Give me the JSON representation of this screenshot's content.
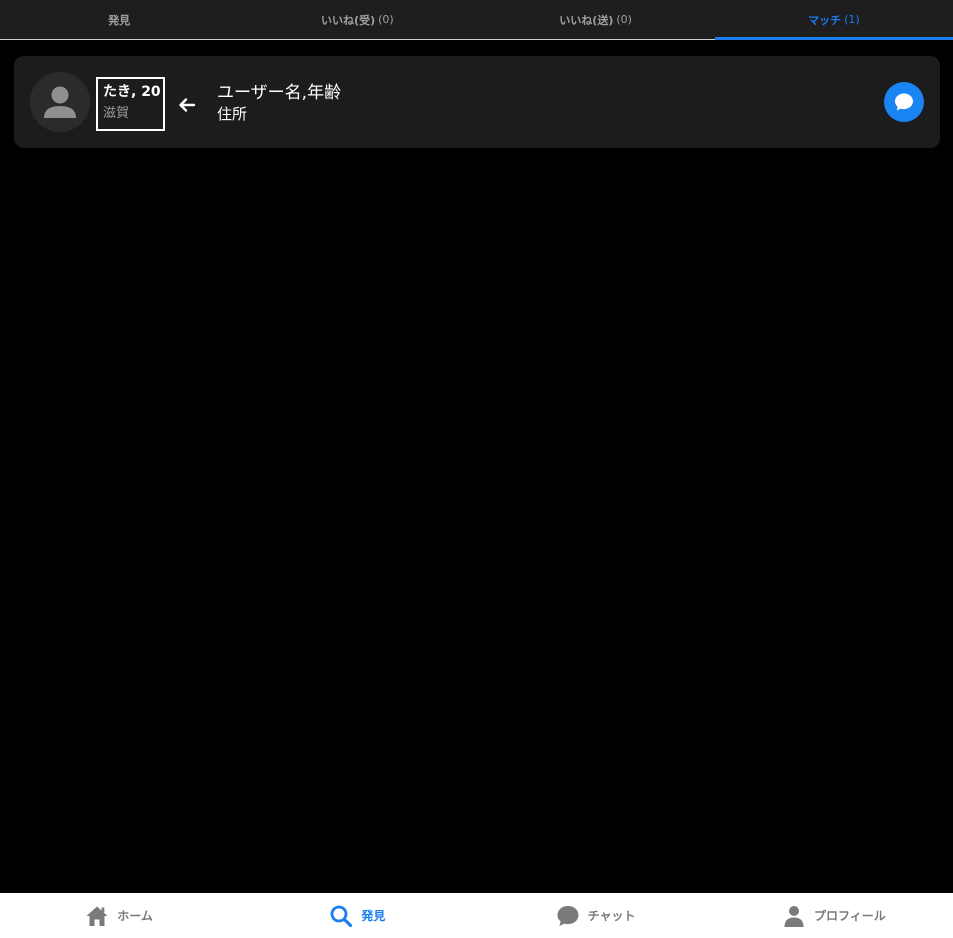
{
  "top_tabs": [
    {
      "label": "発見",
      "count": ""
    },
    {
      "label": "いいね(受)",
      "count": "(0)"
    },
    {
      "label": "いいね(送)",
      "count": "(0)"
    },
    {
      "label": "マッチ",
      "count": "(1)"
    }
  ],
  "match_card": {
    "name_age": "たき, 20",
    "prefecture": "滋賀",
    "hint_title": "ユーザー名,年齢",
    "hint_sub": "住所"
  },
  "bottom_nav": [
    {
      "label": "ホーム",
      "icon": "home-icon"
    },
    {
      "label": "発見",
      "icon": "search-icon"
    },
    {
      "label": "チャット",
      "icon": "chat-bubble-icon"
    },
    {
      "label": "プロフィール",
      "icon": "person-icon"
    }
  ],
  "colors": {
    "accent": "#1a7ef0",
    "background": "#000000",
    "card": "#1c1c1c",
    "inactive": "#7a7a7a"
  }
}
